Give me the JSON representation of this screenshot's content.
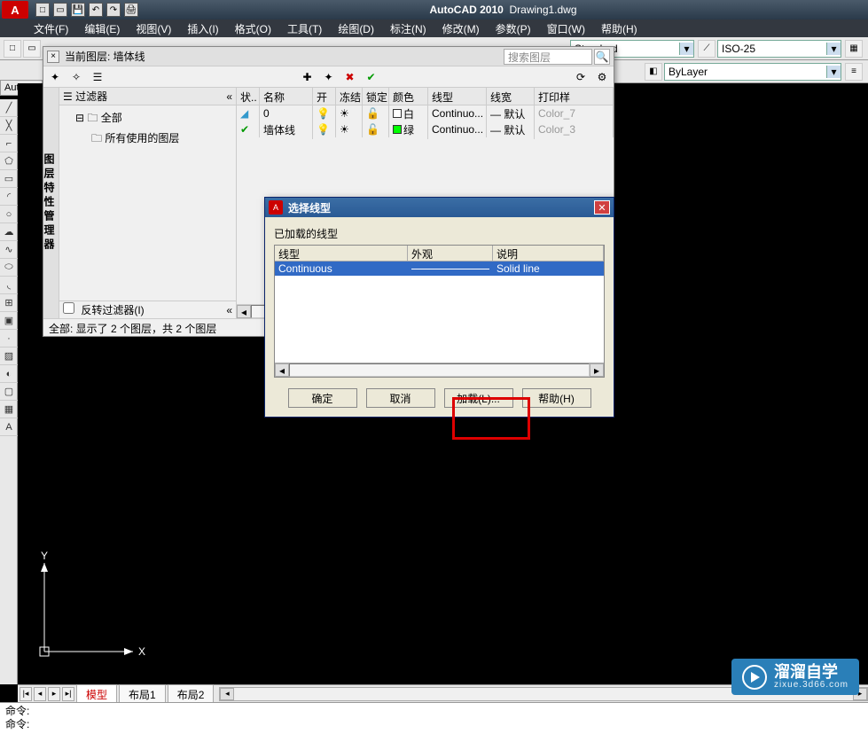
{
  "app": {
    "name": "AutoCAD 2010",
    "doc": "Drawing1.dwg",
    "logo": "A"
  },
  "menus": [
    "文件(F)",
    "编辑(E)",
    "视图(V)",
    "插入(I)",
    "格式(O)",
    "工具(T)",
    "绘图(D)",
    "标注(N)",
    "修改(M)",
    "参数(P)",
    "窗口(W)",
    "帮助(H)"
  ],
  "toolbar": {
    "style_select": "Standard",
    "dim_select": "ISO-25",
    "layer_select": "ByLayer"
  },
  "autoca_label": "AutoCA",
  "layer_panel": {
    "sidebar_title": "图层特性管理器",
    "current": "当前图层: 墙体线",
    "search_placeholder": "搜索图层",
    "filter_header": "过滤器",
    "tree_root": "全部",
    "tree_child": "所有使用的图层",
    "invert_label": "反转过滤器(I)",
    "status_text": "全部: 显示了 2 个图层，共 2 个图层",
    "cols": {
      "stat": "状..",
      "name": "名称",
      "on": "开",
      "frz": "冻结",
      "lock": "锁定",
      "color": "颜色",
      "lt": "线型",
      "lw": "线宽",
      "plot": "打印样"
    },
    "rows": [
      {
        "name": "0",
        "on": "💡",
        "frz": "☀",
        "lock": "🔓",
        "color": "白",
        "swatch": "#fff",
        "lt": "Continuo...",
        "lw": "— 默认",
        "plot": "Color_7"
      },
      {
        "name": "墙体线",
        "on": "💡",
        "frz": "☀",
        "lock": "🔓",
        "color": "绿",
        "swatch": "#0f0",
        "lt": "Continuo...",
        "lw": "— 默认",
        "plot": "Color_3"
      }
    ]
  },
  "dialog": {
    "title": "选择线型",
    "loaded_label": "已加载的线型",
    "cols": {
      "lt": "线型",
      "appear": "外观",
      "desc": "说明"
    },
    "row": {
      "lt": "Continuous",
      "desc": "Solid line"
    },
    "btns": {
      "ok": "确定",
      "cancel": "取消",
      "load": "加载(L)...",
      "help": "帮助(H)"
    }
  },
  "tabs": {
    "model": "模型",
    "layout1": "布局1",
    "layout2": "布局2"
  },
  "cmd": {
    "prompt1": "命令:",
    "prompt2": "命令:"
  },
  "wcs": {
    "x": "X",
    "y": "Y"
  },
  "watermark": {
    "title": "溜溜自学",
    "sub": "zixue.3d66.com"
  }
}
